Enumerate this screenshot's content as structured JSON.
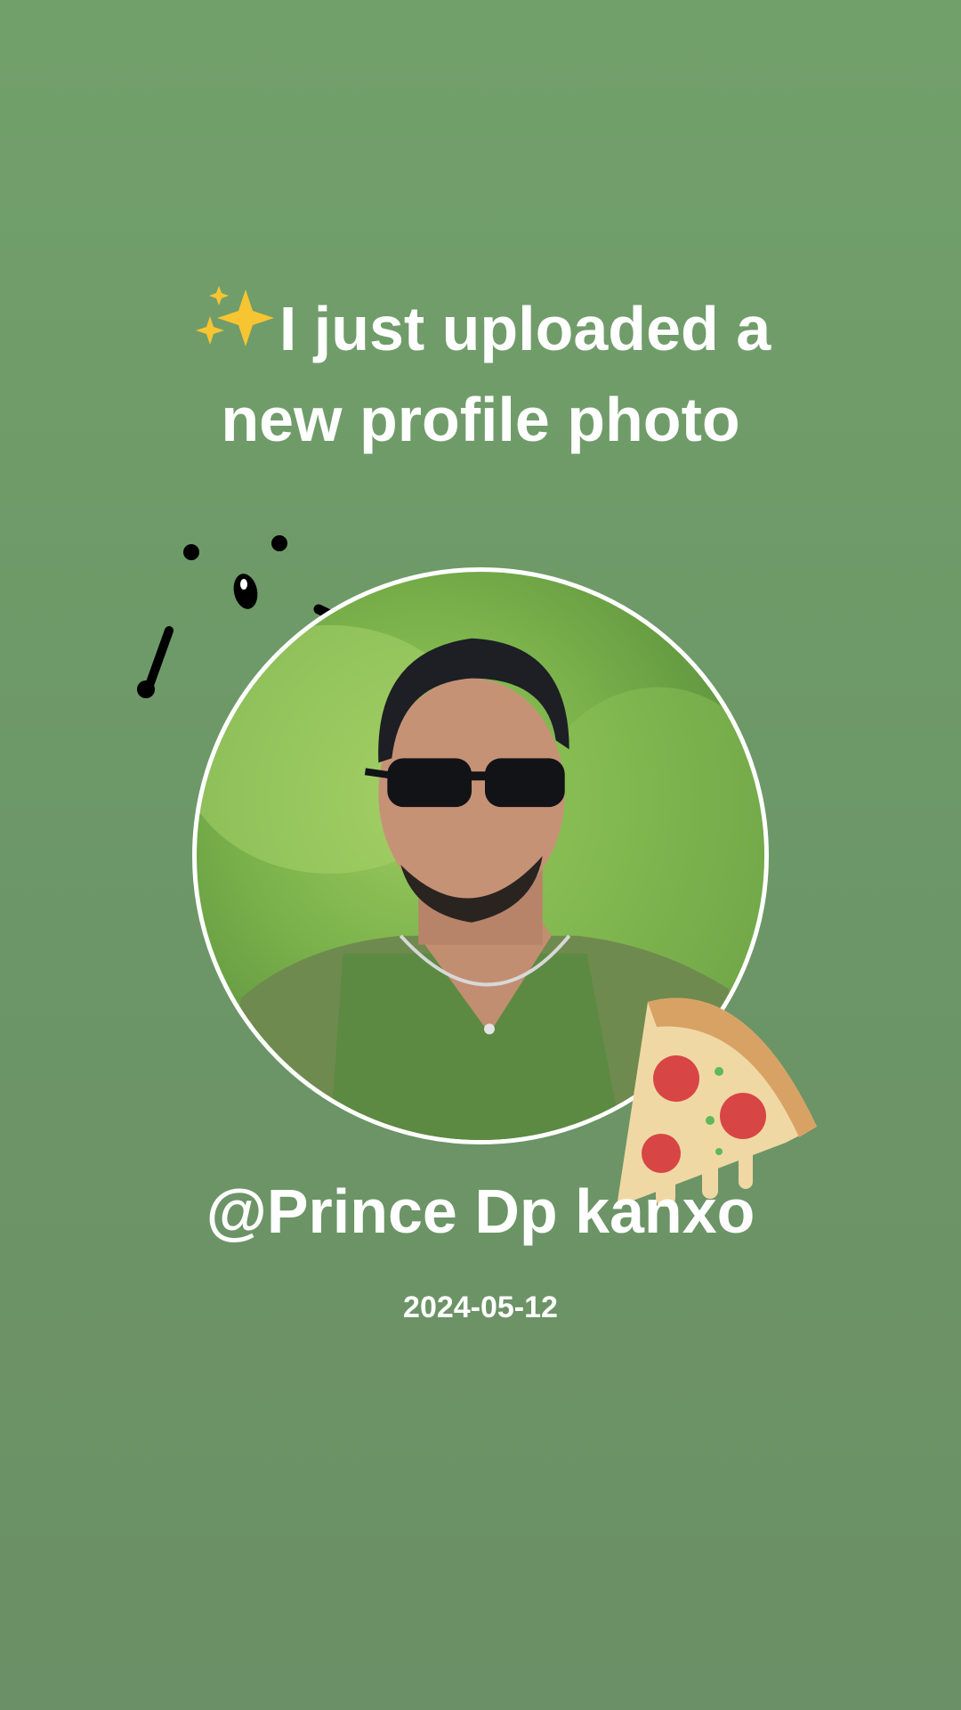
{
  "post": {
    "headline_line1": "I just uploaded a",
    "headline_line2": "new profile photo",
    "headline_icon": "sparkles-icon",
    "username": "@Prince Dp kanxo",
    "date": "2024-05-12"
  },
  "decorations": {
    "doodle": "face-doodle-icon",
    "sticker": "pizza-slice-icon"
  },
  "colors": {
    "background": "#6e9a68",
    "text": "#ffffff",
    "avatar_border": "#ffffff",
    "sparkle": "#f7c531"
  }
}
